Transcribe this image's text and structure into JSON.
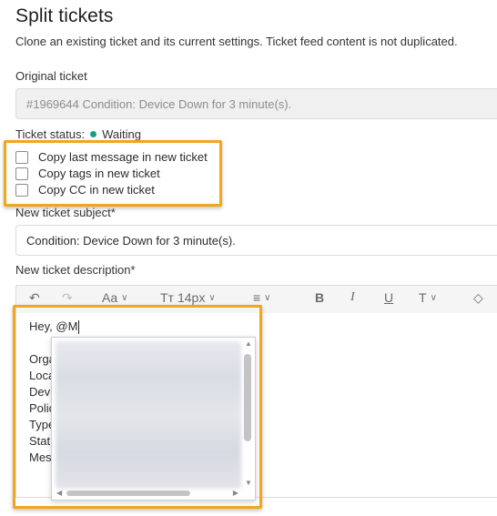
{
  "header": {
    "title": "Split tickets",
    "subtitle": "Clone an existing ticket and its current settings. Ticket feed content is not duplicated."
  },
  "original_ticket": {
    "label": "Original ticket",
    "value": "#1969644 Condition: Device Down for 3 minute(s)."
  },
  "status": {
    "label": "Ticket status:",
    "value": "Waiting",
    "color": "#1a9e8a"
  },
  "options": [
    {
      "label": "Copy last message in new ticket",
      "checked": false
    },
    {
      "label": "Copy tags in new ticket",
      "checked": false
    },
    {
      "label": "Copy CC in new ticket",
      "checked": false
    }
  ],
  "subject": {
    "label": "New ticket subject*",
    "value": "Condition: Device Down for 3 minute(s)."
  },
  "description": {
    "label": "New ticket description*",
    "toolbar": {
      "font_label": "Aa",
      "size_label": "14px"
    },
    "first_line": "Hey, @M",
    "partial_lines": [
      "Orga",
      "Loca",
      "Devi",
      "Polic",
      "Type",
      "Stat",
      "Mes"
    ]
  },
  "colors": {
    "highlight": "#f2a51e",
    "status_dot": "#1a9e8a"
  }
}
